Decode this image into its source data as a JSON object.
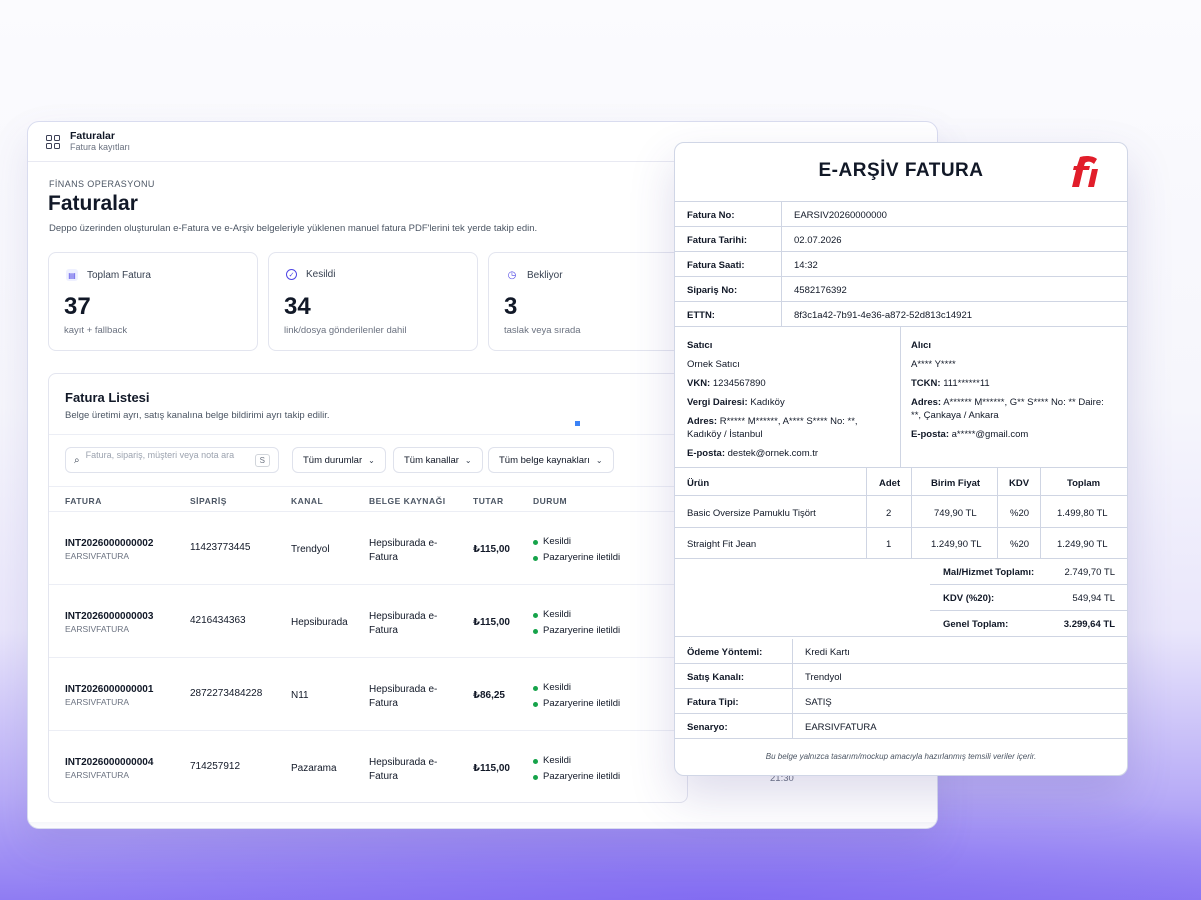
{
  "window": {
    "title": "Faturalar",
    "subtitle": "Fatura kayıtları"
  },
  "page": {
    "eyebrow": "FİNANS OPERASYONU",
    "title": "Faturalar",
    "description": "Deppo üzerinden oluşturulan e-Fatura ve e-Arşiv belgeleriyle yüklenen manuel fatura PDF'lerini tek yerde takip edin."
  },
  "stats": [
    {
      "label": "Toplam Fatura",
      "value": "37",
      "caption": "kayıt + fallback",
      "icon": "document-icon",
      "color": "#4f46e5"
    },
    {
      "label": "Kesildi",
      "value": "34",
      "caption": "link/dosya gönderilenler dahil",
      "icon": "check-circle-icon",
      "color": "#4f46e5"
    },
    {
      "label": "Bekliyor",
      "value": "3",
      "caption": "taslak veya sırada",
      "icon": "clock-icon",
      "color": "#4f46e5"
    }
  ],
  "list": {
    "title": "Fatura Listesi",
    "description": "Belge üretimi ayrı, satış kanalına belge bildirimi ayrı takip edilir.",
    "search_placeholder": "Fatura, sipariş, müşteri veya nota ara",
    "search_shortcut": "S",
    "filters": [
      "Tüm durumlar",
      "Tüm kanallar",
      "Tüm belge kaynakları"
    ],
    "columns": [
      "FATURA",
      "SİPARİŞ",
      "KANAL",
      "BELGE KAYNAĞI",
      "TUTAR",
      "DURUM"
    ],
    "rows": [
      {
        "invoice": "INT2026000000002",
        "type": "EARSIVFATURA",
        "order": "11423773445",
        "channel": "Trendyol",
        "source_1": "Hepsiburada e-",
        "source_2": "Fatura",
        "amount": "₺115,00",
        "status_1": "Kesildi",
        "status_2": "Pazaryerine iletildi"
      },
      {
        "invoice": "INT2026000000003",
        "type": "EARSIVFATURA",
        "order": "4216434363",
        "channel": "Hepsiburada",
        "source_1": "Hepsiburada e-",
        "source_2": "Fatura",
        "amount": "₺115,00",
        "status_1": "Kesildi",
        "status_2": "Pazaryerine iletildi"
      },
      {
        "invoice": "INT2026000000001",
        "type": "EARSIVFATURA",
        "order": "2872273484228",
        "channel": "N11",
        "source_1": "Hepsiburada e-",
        "source_2": "Fatura",
        "amount": "₺86,25",
        "status_1": "Kesildi",
        "status_2": "Pazaryerine iletildi"
      },
      {
        "invoice": "INT2026000000004",
        "type": "EARSIVFATURA",
        "order": "714257912",
        "channel": "Pazarama",
        "source_1": "Hepsiburada e-",
        "source_2": "Fatura",
        "amount": "₺115,00",
        "status_1": "Kesildi",
        "status_2": "Pazaryerine iletildi"
      }
    ],
    "partial_time": "21:30"
  },
  "invoice": {
    "title": "E-ARŞİV FATURA",
    "fields": [
      {
        "label": "Fatura No:",
        "value": "EARSIV20260000000"
      },
      {
        "label": "Fatura Tarihi:",
        "value": "02.07.2026"
      },
      {
        "label": "Fatura Saati:",
        "value": "14:32"
      },
      {
        "label": "Sipariş No:",
        "value": "4582176392"
      },
      {
        "label": "ETTN:",
        "value": "8f3c1a42-7b91-4e36-a872-52d813c14921"
      }
    ],
    "seller": {
      "heading": "Satıcı",
      "name": "Ornek Satıcı",
      "vkn_label": "VKN:",
      "vkn": "1234567890",
      "tax_office_label": "Vergi Dairesi:",
      "tax_office": "Kadıköy",
      "address_label": "Adres:",
      "address": "R***** M******, A**** S**** No: **, Kadıköy / İstanbul",
      "email_label": "E-posta:",
      "email": "destek@ornek.com.tr"
    },
    "buyer": {
      "heading": "Alıcı",
      "name": "A**** Y****",
      "tckn_label": "TCKN:",
      "tckn": "111******11",
      "address_label": "Adres:",
      "address": "A****** M******, G** S**** No: ** Daire: **, Çankaya / Ankara",
      "email_label": "E-posta:",
      "email": "a*****@gmail.com"
    },
    "product_columns": [
      "Ürün",
      "Adet",
      "Birim Fiyat",
      "KDV",
      "Toplam"
    ],
    "products": [
      {
        "name": "Basic Oversize Pamuklu Tişört",
        "qty": "2",
        "unit": "749,90 TL",
        "vat": "%20",
        "total": "1.499,80 TL"
      },
      {
        "name": "Straight Fit Jean",
        "qty": "1",
        "unit": "1.249,90 TL",
        "vat": "%20",
        "total": "1.249,90 TL"
      }
    ],
    "totals": [
      {
        "label": "Mal/Hizmet Toplamı:",
        "value": "2.749,70 TL"
      },
      {
        "label": "KDV (%20):",
        "value": "549,94 TL"
      },
      {
        "label": "Genel Toplam:",
        "value": "3.299,64 TL"
      }
    ],
    "meta": [
      {
        "label": "Ödeme Yöntemi:",
        "value": "Kredi Kartı"
      },
      {
        "label": "Satış Kanalı:",
        "value": "Trendyol"
      },
      {
        "label": "Fatura Tipi:",
        "value": "SATIŞ"
      },
      {
        "label": "Senaryo:",
        "value": "EARSIVFATURA"
      }
    ],
    "footer": "Bu belge yalnızca tasarım/mockup amacıyla hazırlanmış temsili veriler içerir.",
    "logo_color": "#e11d2a"
  }
}
